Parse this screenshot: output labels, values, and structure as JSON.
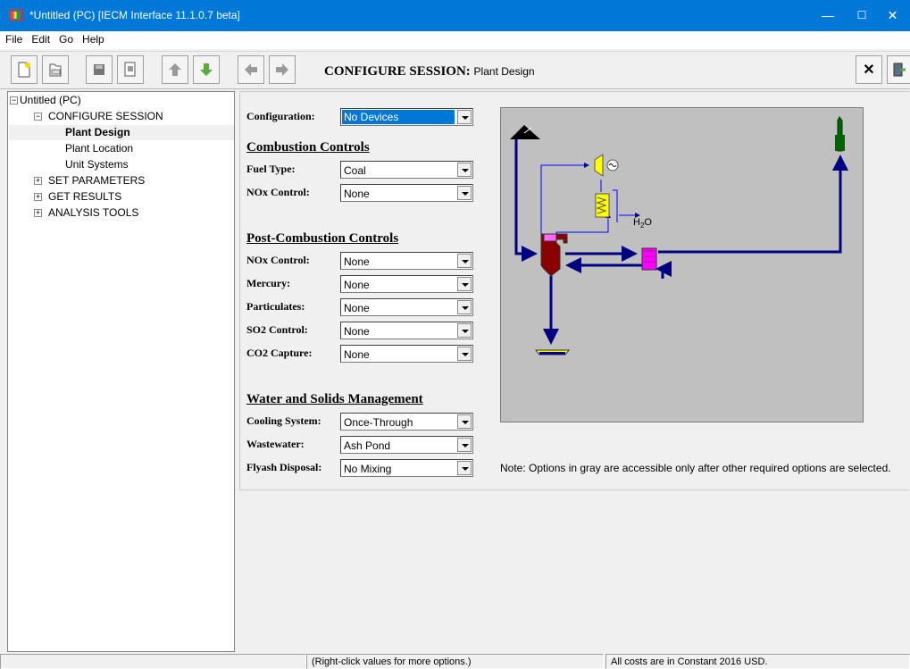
{
  "window": {
    "title": "*Untitled (PC) [IECM Interface 11.1.0.7 beta]",
    "controls": {
      "minimize": "—",
      "maximize": "☐",
      "close": "✕"
    }
  },
  "menu": [
    "File",
    "Edit",
    "Go",
    "Help"
  ],
  "toolbar": {
    "buttons": [
      "new-icon",
      "open-icon",
      "save-icon",
      "report-icon",
      "up-arrow-icon",
      "down-arrow-icon",
      "back-arrow-icon",
      "forward-arrow-icon"
    ],
    "session_title": "CONFIGURE SESSION:",
    "session_sub": "Plant Design",
    "close_label": "✕"
  },
  "tree": {
    "root": "Untitled (PC)",
    "configure": "CONFIGURE SESSION",
    "plant_design": "Plant Design",
    "plant_location": "Plant Location",
    "unit_systems": "Unit Systems",
    "set_parameters": "SET PARAMETERS",
    "get_results": "GET RESULTS",
    "analysis_tools": "ANALYSIS TOOLS"
  },
  "form": {
    "configuration": {
      "label": "Configuration:",
      "value": "No Devices"
    },
    "combustion_title": "Combustion Controls",
    "fuel_type": {
      "label": "Fuel Type:",
      "value": "Coal"
    },
    "nox_combustion": {
      "label": "NOx Control:",
      "value": "None"
    },
    "post_title": "Post-Combustion Controls",
    "nox_post": {
      "label": "NOx Control:",
      "value": "None"
    },
    "mercury": {
      "label": "Mercury:",
      "value": "None"
    },
    "particulates": {
      "label": "Particulates:",
      "value": "None"
    },
    "so2": {
      "label": "SO2 Control:",
      "value": "None"
    },
    "co2": {
      "label": "CO2 Capture:",
      "value": "None"
    },
    "water_title": "Water and Solids Management",
    "cooling": {
      "label": "Cooling System:",
      "value": "Once-Through"
    },
    "wastewater": {
      "label": "Wastewater:",
      "value": "Ash Pond"
    },
    "flyash": {
      "label": "Flyash Disposal:",
      "value": "No Mixing"
    }
  },
  "diagram": {
    "water_label": "H",
    "water_sub": "2",
    "water_tail": "O",
    "colors": {
      "flow": "#000080",
      "boiler": "#8b0000",
      "heater": "#ff00ff",
      "turbine": "#ffff00",
      "stack": "#006400"
    }
  },
  "note": "Note: Options in gray are accessible only after other required options are selected.",
  "status": {
    "hint": "(Right-click values for more options.)",
    "costs": "All costs are in Constant 2016 USD."
  }
}
